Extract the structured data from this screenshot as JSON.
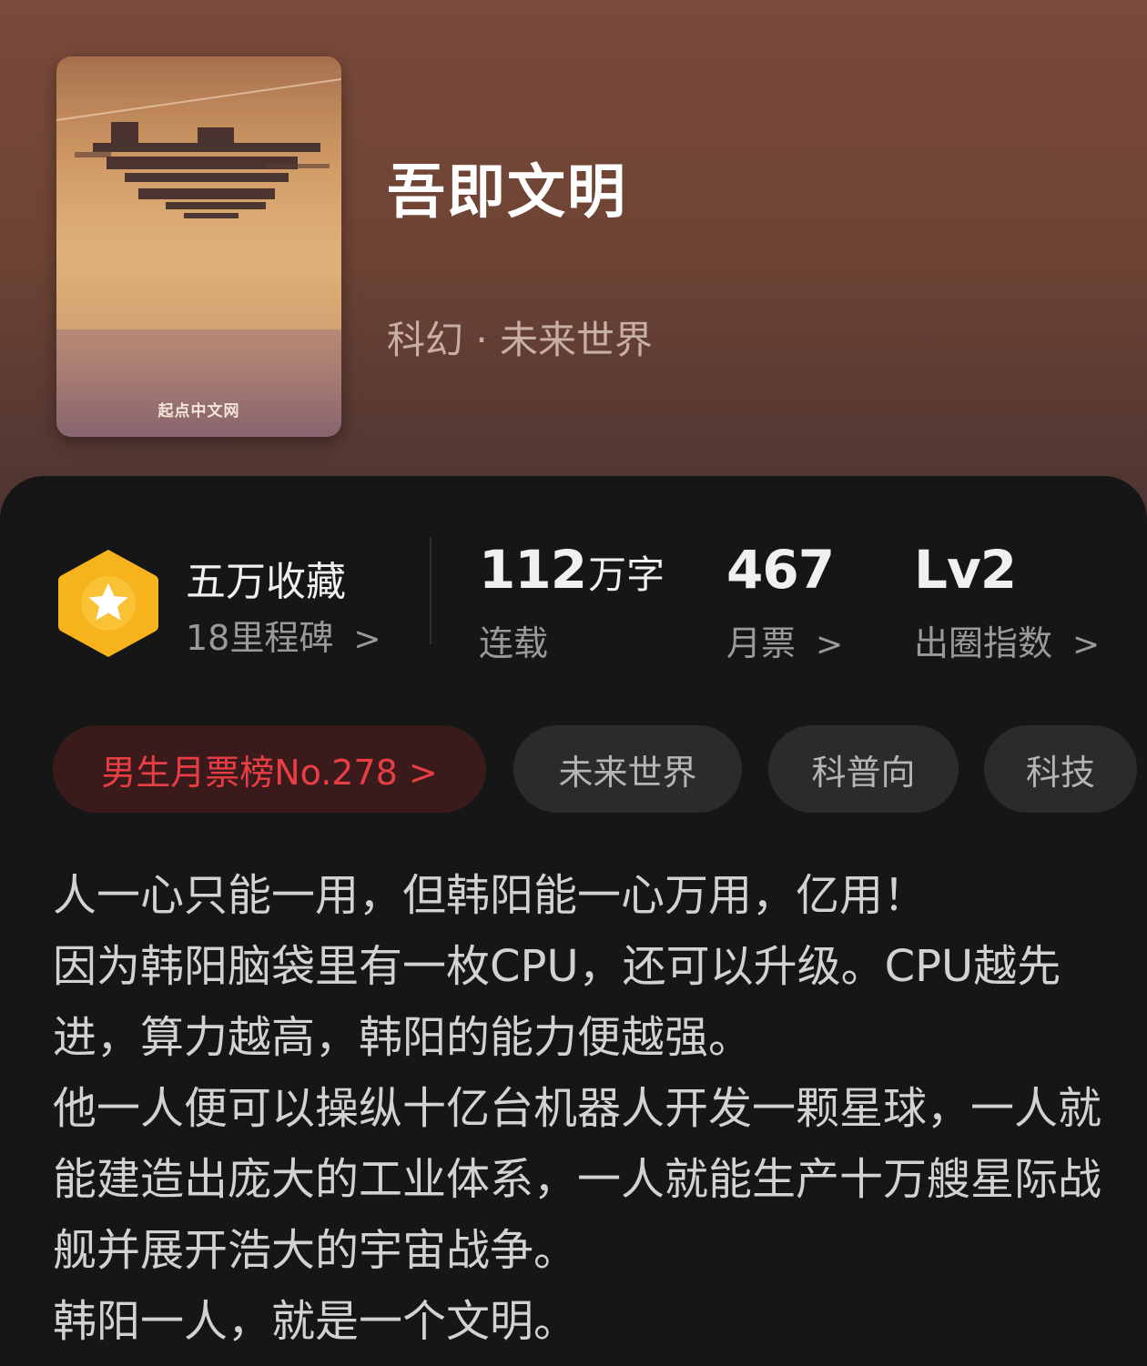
{
  "book": {
    "title": "吾即文明",
    "genre": "科幻 · 未来世界",
    "cover_watermark": "起点中文网"
  },
  "stats": {
    "collection_title": "五万收藏",
    "collection_sub": "18里程碑",
    "chevron": ">",
    "words_number": "112",
    "words_unit": "万字",
    "words_label": "连载",
    "votes_number": "467",
    "votes_label": "月票",
    "level_value": "Lv2",
    "level_label": "出圈指数"
  },
  "tags": {
    "rank": "男生月票榜No.278 >",
    "items": [
      "未来世界",
      "科普向",
      "科技"
    ]
  },
  "description": [
    "人一心只能一用，但韩阳能一心万用，亿用！",
    "因为韩阳脑袋里有一枚CPU，还可以升级。CPU越先进，算力越高，韩阳的能力便越强。",
    "他一人便可以操纵十亿台机器人开发一颗星球，一人就能建造出庞大的工业体系，一人就能生产十万艘星际战舰并展开浩大的宇宙战争。",
    "韩阳一人，就是一个文明。"
  ],
  "colors": {
    "badge": "#f7b31b",
    "rank_text": "#ea3e45",
    "rank_bg": "#3a1a1b"
  }
}
